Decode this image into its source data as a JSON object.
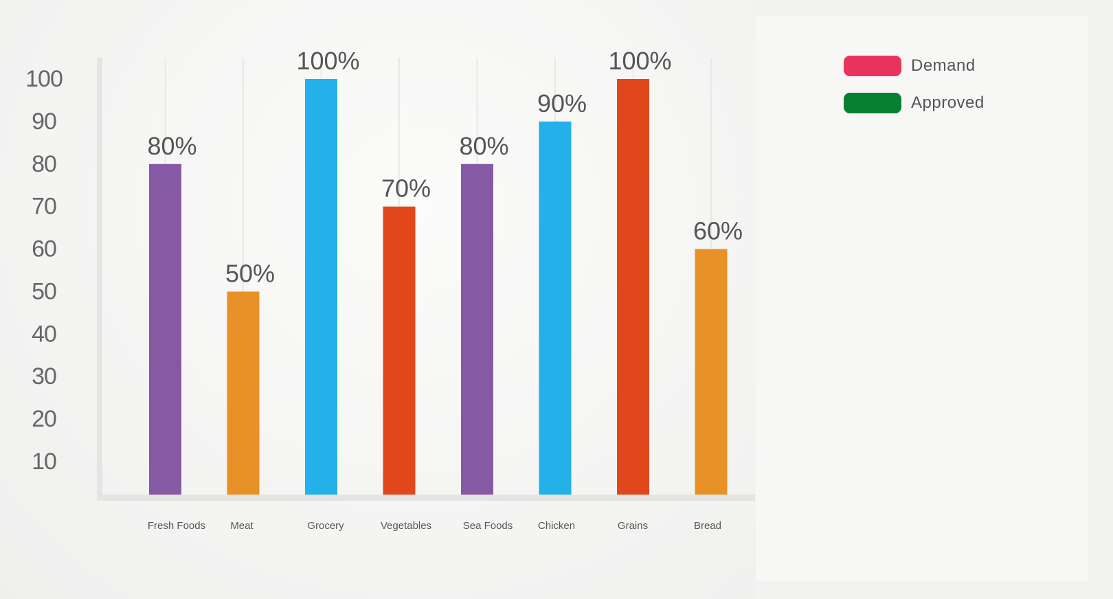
{
  "legend": {
    "items": [
      {
        "label": "Demand",
        "color": "#e8345c"
      },
      {
        "label": "Approved",
        "color": "#077f31"
      }
    ]
  },
  "chart_data": {
    "type": "bar",
    "categories": [
      "Fresh Foods",
      "Meat",
      "Grocery",
      "Vegetables",
      "Sea Foods",
      "Chicken",
      "Grains",
      "Bread"
    ],
    "values": [
      80,
      50,
      100,
      70,
      80,
      90,
      100,
      60
    ],
    "data_labels": [
      "80%",
      "50%",
      "100%",
      "70%",
      "80%",
      "90%",
      "100%",
      "60%"
    ],
    "bar_colors": [
      "#8659a5",
      "#e79127",
      "#24b0e8",
      "#e2471c",
      "#8659a5",
      "#24b0e8",
      "#e2471c",
      "#e79127"
    ],
    "yticks": [
      10,
      20,
      30,
      40,
      50,
      60,
      70,
      80,
      90,
      100
    ],
    "ylim": [
      0,
      110
    ],
    "grid": "vertical",
    "legend_position": "right",
    "title": "",
    "xlabel": "",
    "ylabel": ""
  }
}
